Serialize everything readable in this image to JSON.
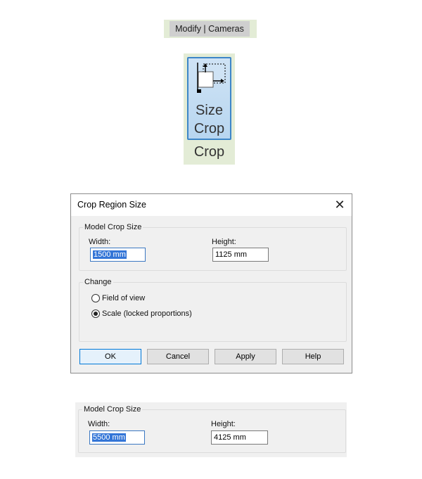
{
  "ribbon": {
    "tab_label": "Modify | Cameras",
    "button": {
      "line1": "Size",
      "line2": "Crop",
      "icon": "size-crop-icon"
    },
    "panel_label": "Crop"
  },
  "dialog": {
    "title": "Crop Region Size",
    "close_icon": "close-icon",
    "model_crop_size": {
      "legend": "Model Crop Size",
      "width_label": "Width:",
      "width_value": "1500 mm",
      "height_label": "Height:",
      "height_value": "1125 mm"
    },
    "change": {
      "legend": "Change",
      "options": [
        {
          "label": "Field of view",
          "checked": false
        },
        {
          "label": "Scale (locked proportions)",
          "checked": true
        }
      ]
    },
    "buttons": {
      "ok": "OK",
      "cancel": "Cancel",
      "apply": "Apply",
      "help": "Help"
    }
  },
  "second_panel": {
    "legend": "Model Crop Size",
    "width_label": "Width:",
    "width_value": "5500 mm",
    "height_label": "Height:",
    "height_value": "4125 mm"
  },
  "colors": {
    "ribbon_bg": "#e3ecd6",
    "button_active": "#b8d6f0",
    "button_border": "#3d86c8",
    "selection": "#3375d7",
    "dialog_bg": "#f0f0f0"
  }
}
